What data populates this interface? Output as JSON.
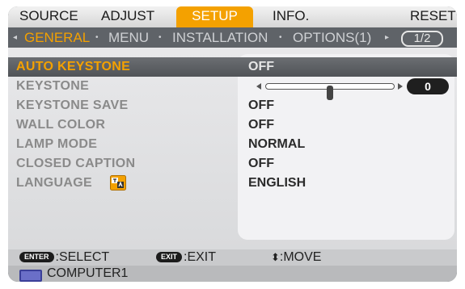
{
  "top_tabs": [
    {
      "label": "SOURCE",
      "active": false
    },
    {
      "label": "ADJUST",
      "active": false
    },
    {
      "label": "SETUP",
      "active": true
    },
    {
      "label": "INFO.",
      "active": false
    },
    {
      "label": "RESET",
      "active": false
    }
  ],
  "sub_tabs": {
    "left_arrow": "◂",
    "items": [
      {
        "label": "GENERAL",
        "active": true
      },
      {
        "label": "MENU",
        "active": false
      },
      {
        "label": "INSTALLATION",
        "active": false
      },
      {
        "label": "OPTIONS(1)",
        "active": false
      }
    ],
    "bullet": "•",
    "right_arrow": "▸",
    "page_indicator": "1/2"
  },
  "settings": [
    {
      "label": "AUTO KEYSTONE",
      "value": "OFF",
      "selected": true
    },
    {
      "label": "KEYSTONE",
      "value": "0",
      "control": "slider",
      "slider_fraction": 0.5
    },
    {
      "label": "KEYSTONE SAVE",
      "value": "OFF"
    },
    {
      "label": "WALL COLOR",
      "value": "OFF"
    },
    {
      "label": "LAMP MODE",
      "value": "NORMAL"
    },
    {
      "label": "CLOSED CAPTION",
      "value": "OFF"
    },
    {
      "label": "LANGUAGE",
      "value": "ENGLISH",
      "icon": "language-icon"
    }
  ],
  "footer": {
    "enter_key": "ENTER",
    "enter_action": ":SELECT",
    "exit_key": "EXIT",
    "exit_action": ":EXIT",
    "move_glyph": "⬍",
    "move_action": ":MOVE"
  },
  "status": {
    "icon": "computer-input-icon",
    "source": "COMPUTER1"
  },
  "colors": {
    "accent": "#f4a100",
    "frame": "#55585c",
    "panel": "#e8e8ea"
  }
}
